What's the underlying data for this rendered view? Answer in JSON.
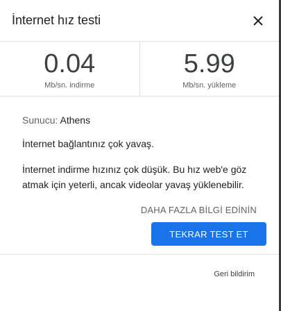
{
  "dialog": {
    "title": "İnternet hız testi",
    "close_icon": "close-icon"
  },
  "stats": {
    "download": {
      "value": "0.04",
      "unit": "Mb/sn. indirme"
    },
    "upload": {
      "value": "5.99",
      "unit": "Mb/sn. yükleme"
    }
  },
  "server": {
    "label": "Sunucu:",
    "value": "Athens"
  },
  "messages": {
    "slow": "İnternet bağlantınız çok yavaş.",
    "detail": "İnternet indirme hızınız çok düşük. Bu hız web'e göz atmak için yeterli, ancak videolar yavaş yüklenebilir."
  },
  "actions": {
    "learn_more": "DAHA FAZLA BİLGİ EDİNİN",
    "retest": "TEKRAR TEST ET"
  },
  "footer": {
    "feedback": "Geri bildirim"
  },
  "colors": {
    "accent": "#1a73e8",
    "text": "#202124",
    "muted": "#5f6368",
    "border": "#e0e0e0"
  }
}
